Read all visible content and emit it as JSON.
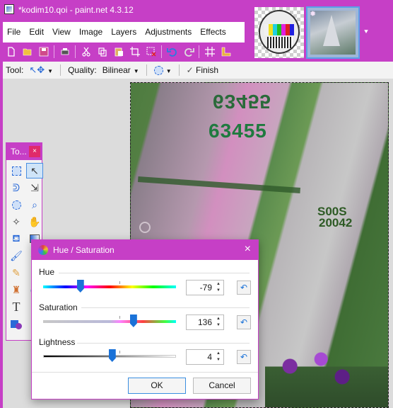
{
  "window": {
    "title": "*kodim10.qoi - paint.net 4.3.12"
  },
  "menu": {
    "items": [
      "File",
      "Edit",
      "View",
      "Image",
      "Layers",
      "Adjustments",
      "Effects"
    ]
  },
  "toolbar_icons": [
    "new-icon",
    "open-icon",
    "save-icon",
    "print-icon",
    "cut-icon",
    "copy-icon",
    "paste-icon",
    "crop-icon",
    "deselect-icon",
    "undo-icon",
    "redo-icon",
    "grid-icon",
    "ruler-icon"
  ],
  "tool_options": {
    "tool_label": "Tool:",
    "quality_label": "Quality:",
    "quality_value": "Bilinear",
    "finish_label": "Finish"
  },
  "canvas": {
    "sail_numbers": [
      "63455",
      "63455",
      "S00S",
      "20042"
    ]
  },
  "tools_window": {
    "title": "To...",
    "close": "×",
    "tools": [
      "rectangle-select-icon",
      "move-selection-icon",
      "lasso-select-icon",
      "move-selected-icon",
      "ellipse-select-icon",
      "zoom-icon",
      "magic-wand-icon",
      "pan-icon",
      "paint-bucket-icon",
      "gradient-icon",
      "paintbrush-icon",
      "eraser-icon",
      "pencil-icon",
      "color-picker-icon",
      "clone-stamp-icon",
      "recolor-icon",
      "text-icon",
      "line-icon",
      "shapes-icon"
    ],
    "text_tool_glyph": "T"
  },
  "dialog": {
    "title": "Hue / Saturation",
    "close": "×",
    "hue": {
      "label": "Hue",
      "value": "-79",
      "min": -180,
      "max": 180,
      "current": -79
    },
    "saturation": {
      "label": "Saturation",
      "value": "136",
      "min": 0,
      "max": 200,
      "current": 136
    },
    "lightness": {
      "label": "Lightness",
      "value": "4",
      "min": -100,
      "max": 100,
      "current": 4
    },
    "ok_label": "OK",
    "cancel_label": "Cancel"
  },
  "colors": {
    "accent": "#c63fc6",
    "slider_knob": "#1a72d8"
  }
}
